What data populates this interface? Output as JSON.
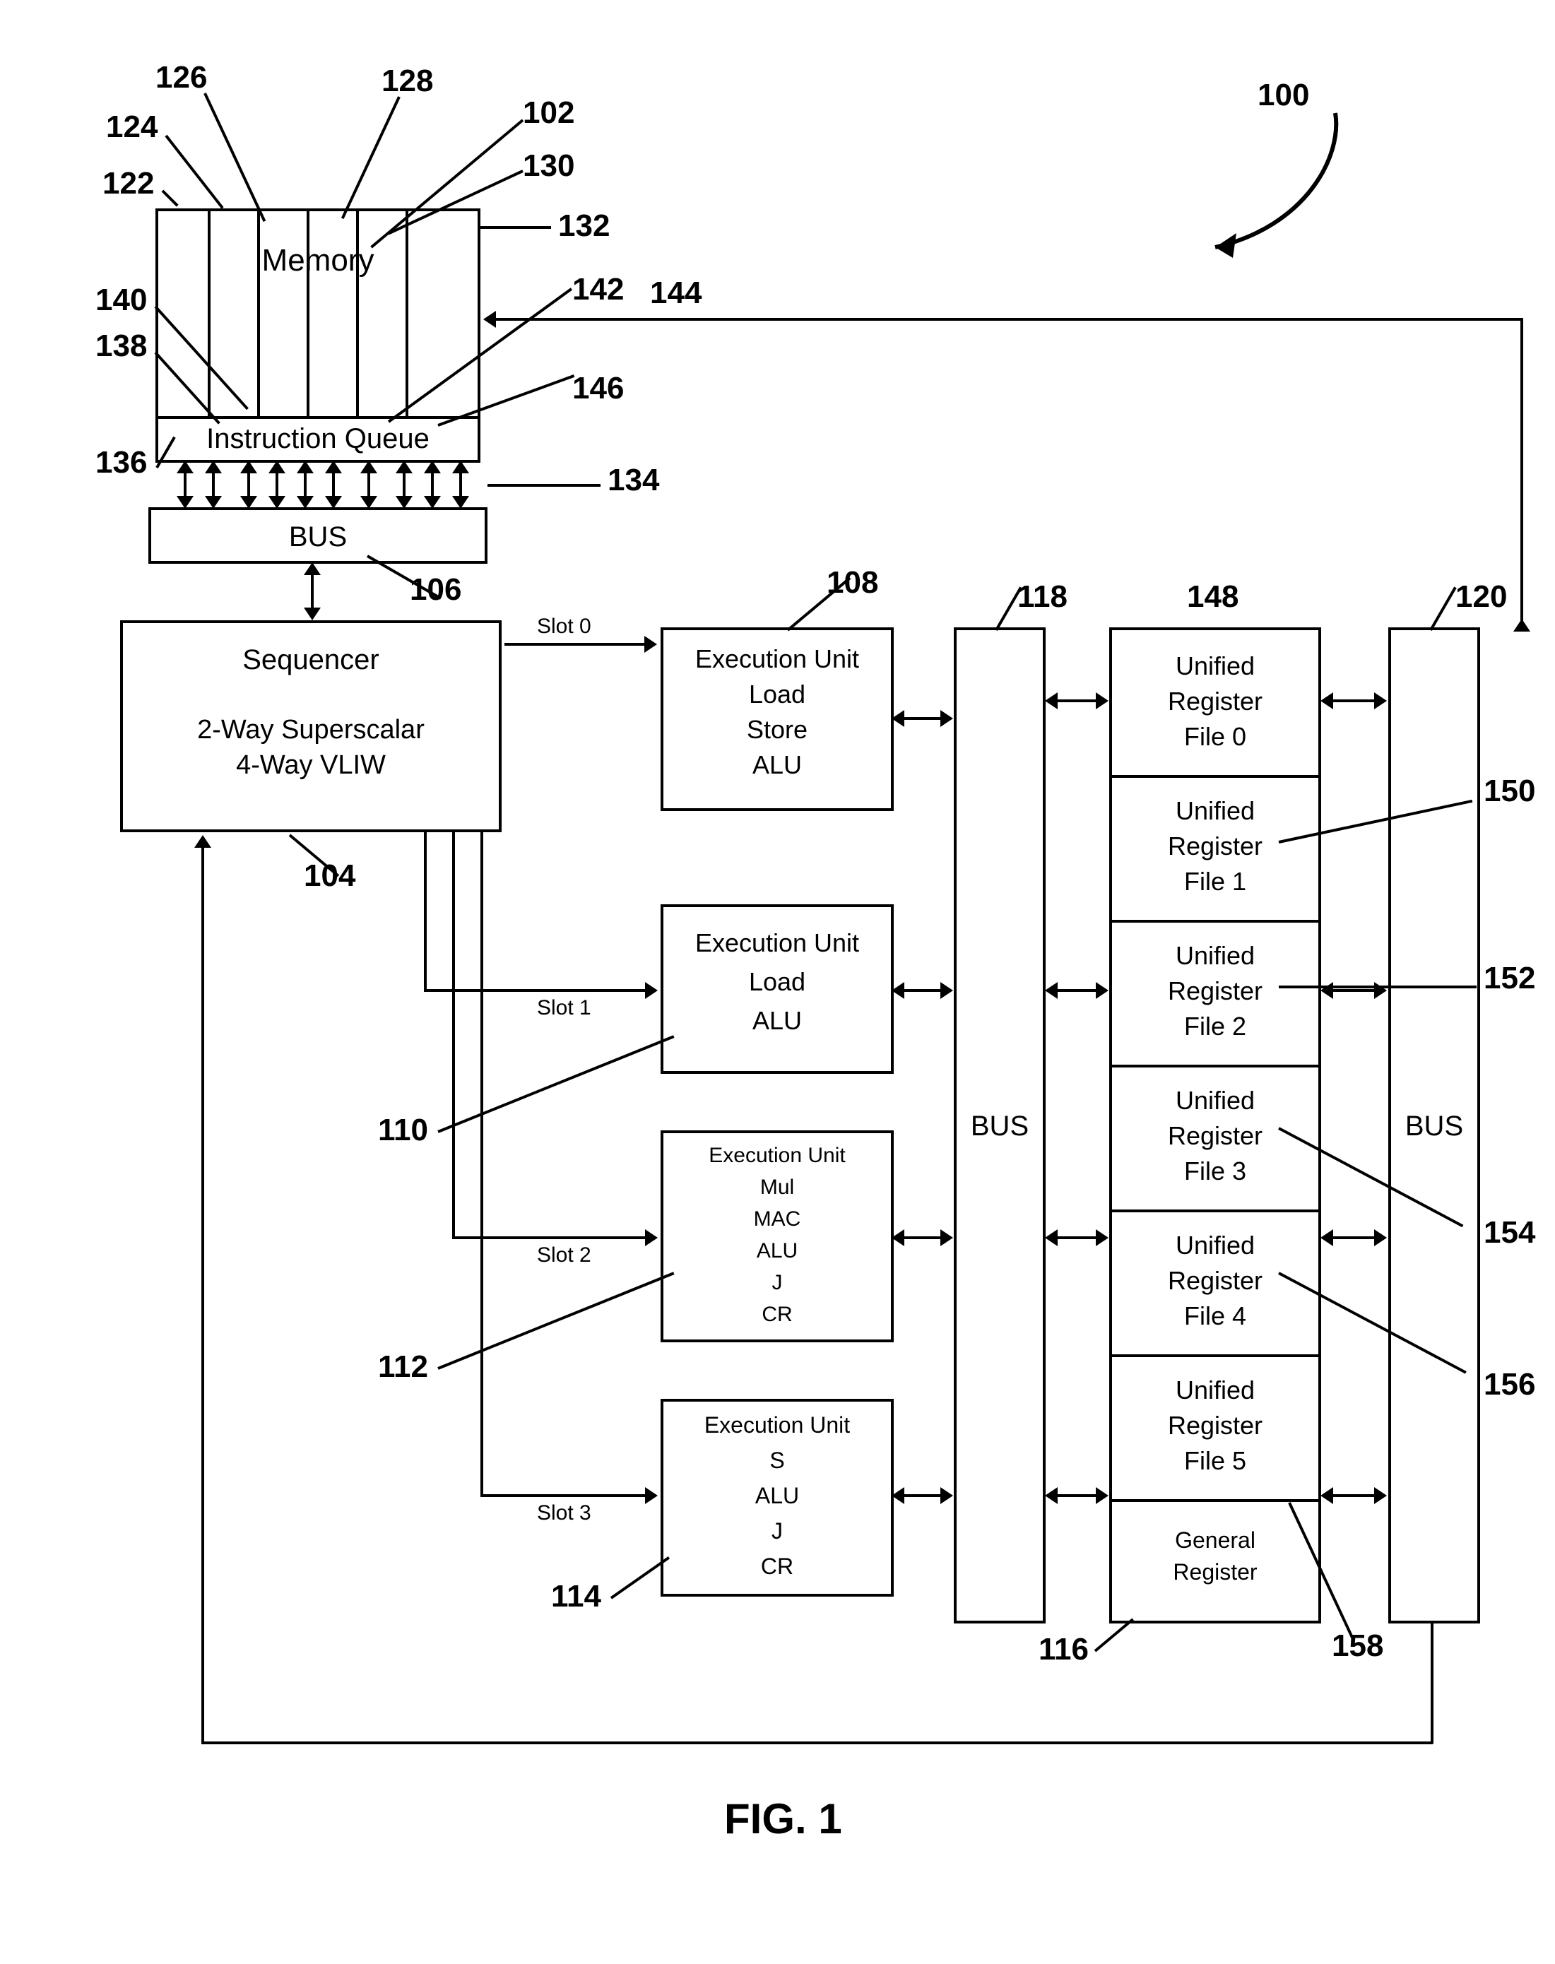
{
  "labels": {
    "l100": "100",
    "l102": "102",
    "l104": "104",
    "l106": "106",
    "l108": "108",
    "l110": "110",
    "l112": "112",
    "l114": "114",
    "l116": "116",
    "l118": "118",
    "l120": "120",
    "l122": "122",
    "l124": "124",
    "l126": "126",
    "l128": "128",
    "l130": "130",
    "l132": "132",
    "l134": "134",
    "l136": "136",
    "l138": "138",
    "l140": "140",
    "l142": "142",
    "l144": "144",
    "l146": "146",
    "l148": "148",
    "l150": "150",
    "l152": "152",
    "l154": "154",
    "l156": "156",
    "l158": "158"
  },
  "memory": {
    "title": "Memory",
    "iq": "Instruction Queue"
  },
  "bus": "BUS",
  "sequencer": {
    "title": "Sequencer",
    "sub1": "2-Way Superscalar",
    "sub2": "4-Way VLIW"
  },
  "slots": {
    "s0": "Slot 0",
    "s1": "Slot 1",
    "s2": "Slot 2",
    "s3": "Slot 3"
  },
  "eu0": {
    "t": "Execution Unit",
    "a": "Load",
    "b": "Store",
    "c": "ALU"
  },
  "eu1": {
    "t": "Execution Unit",
    "a": "Load",
    "b": "ALU"
  },
  "eu2": {
    "t": "Execution Unit",
    "a": "Mul",
    "b": "MAC",
    "c": "ALU",
    "d": "J",
    "e": "CR"
  },
  "eu3": {
    "t": "Execution Unit",
    "a": "S",
    "b": "ALU",
    "c": "J",
    "d": "CR"
  },
  "regs": {
    "r0": {
      "a": "Unified",
      "b": "Register",
      "c": "File 0"
    },
    "r1": {
      "a": "Unified",
      "b": "Register",
      "c": "File 1"
    },
    "r2": {
      "a": "Unified",
      "b": "Register",
      "c": "File 2"
    },
    "r3": {
      "a": "Unified",
      "b": "Register",
      "c": "File 3"
    },
    "r4": {
      "a": "Unified",
      "b": "Register",
      "c": "File 4"
    },
    "r5": {
      "a": "Unified",
      "b": "Register",
      "c": "File 5"
    },
    "gen": "General",
    "gen2": "Register"
  },
  "fig": "FIG. 1"
}
